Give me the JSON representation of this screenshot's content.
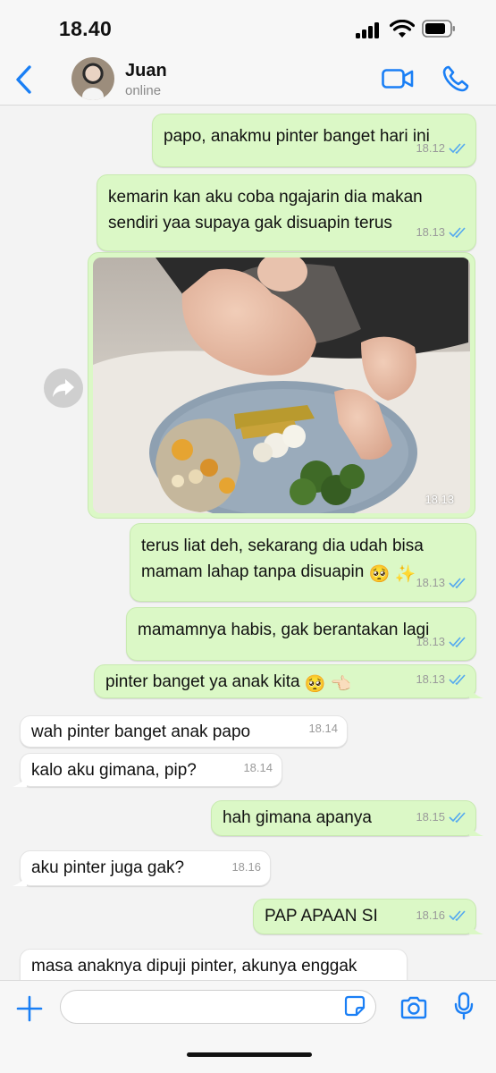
{
  "status_bar": {
    "time": "18.40"
  },
  "header": {
    "contact_name": "Juan",
    "contact_status": "online"
  },
  "messages": [
    {
      "direction": "out",
      "text": "papo, anakmu pinter banget hari ini",
      "time": "18.12",
      "status": "read"
    },
    {
      "direction": "out",
      "lines": [
        "kemarin kan aku coba ngajarin dia makan",
        "sendiri yaa supaya gak disuapin terus"
      ],
      "time": "18.13",
      "status": "read"
    },
    {
      "direction": "out",
      "type": "photo",
      "photo_description": "baby hand reaching a plate of food",
      "time": "18.13",
      "status": "read"
    },
    {
      "direction": "out",
      "lines": [
        "terus liat deh, sekarang dia udah bisa",
        "mamam lahap tanpa disuapin"
      ],
      "emojis": [
        "🥺",
        "✨"
      ],
      "time": "18.13",
      "status": "read"
    },
    {
      "direction": "out",
      "text": "mamamnya habis, gak berantakan lagi",
      "time": "18.13",
      "status": "read"
    },
    {
      "direction": "out",
      "text": "pinter banget ya anak kita",
      "emojis": [
        "🥺",
        "👈🏻"
      ],
      "time": "18.13",
      "status": "read"
    },
    {
      "direction": "in",
      "text": "wah pinter banget anak papo",
      "time": "18.14"
    },
    {
      "direction": "in",
      "text": "kalo aku gimana, pip?",
      "time": "18.14"
    },
    {
      "direction": "out",
      "text": "hah gimana apanya",
      "time": "18.15",
      "status": "read"
    },
    {
      "direction": "in",
      "text": "aku pinter juga gak?",
      "time": "18.16"
    },
    {
      "direction": "out",
      "text": "PAP APAAN SI",
      "time": "18.16",
      "status": "read"
    },
    {
      "direction": "in",
      "text": "masa anaknya dipuji pinter, akunya enggak",
      "time": ""
    }
  ],
  "input": {
    "placeholder": ""
  },
  "colors": {
    "accent": "#1a7ff5",
    "outgoing_bubble": "#dbf8c6",
    "incoming_bubble": "#ffffff",
    "read_ticks": "#53a8f0",
    "chat_background": "#f3f3f3"
  },
  "icons": [
    "back-icon",
    "video-call-icon",
    "voice-call-icon",
    "forward-icon",
    "double-check-icon",
    "plus-icon",
    "sticker-icon",
    "camera-icon",
    "mic-icon",
    "signal-icon",
    "wifi-icon",
    "battery-icon"
  ]
}
